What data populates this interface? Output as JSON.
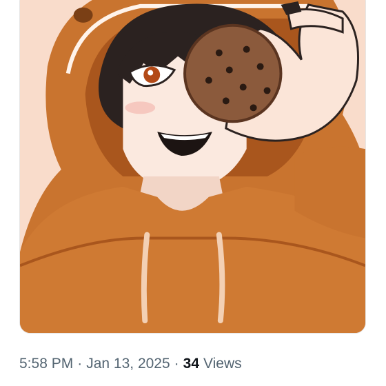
{
  "post": {
    "time": "5:58 PM",
    "date": "Jan 13, 2025",
    "separator": "·",
    "views_count": "34",
    "views_label": "Views"
  },
  "colors": {
    "meta_text": "#536471",
    "count_text": "#0f1419",
    "background_peach": "#f8d7c6",
    "hoodie_orange": "#c9742f",
    "hoodie_shadow": "#a9561d",
    "cookie_brown": "#8b5a3c"
  }
}
